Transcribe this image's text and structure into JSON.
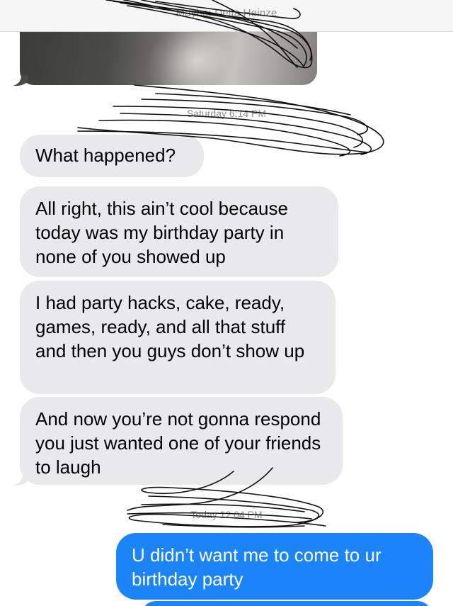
{
  "header": {
    "sender_label": "Maybe: Delta Heinze"
  },
  "timestamps": {
    "first": "Saturday 6:14 PM",
    "second": "Today 12:04 PM"
  },
  "messages": {
    "received": [
      "What happened?",
      "All right, this ain’t cool because today was my birthday party in none of you showed up",
      "I had party hacks, cake, ready, games, ready, and all that stuff and then you guys don’t show up",
      "And now you’re not gonna respond you just wanted one of your friends to laugh"
    ],
    "sent": [
      "U didn’t want me to come to ur birthday party",
      ""
    ]
  },
  "colors": {
    "received_bubble": "#e9e9eb",
    "sent_bubble": "#1a84f8",
    "timestamp_text": "#8e8e93"
  }
}
